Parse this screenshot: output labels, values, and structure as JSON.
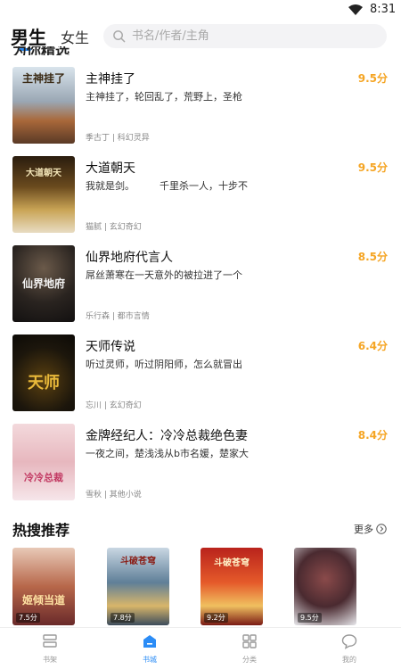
{
  "status_bar": {
    "time": "8:31"
  },
  "tabs": {
    "male": "男生",
    "female": "女生"
  },
  "search": {
    "placeholder": "书名/作者/主角"
  },
  "partial_section_title": "为你精选",
  "books": [
    {
      "title": "主神挂了",
      "desc": "主神挂了，轮回乱了，荒野上，圣枪",
      "author": "季古丁",
      "category": "科幻灵异",
      "score": "9.5分",
      "cover_text": "主神挂了"
    },
    {
      "title": "大道朝天",
      "desc": "我就是剑。        千里杀一人，十步不",
      "author": "猫腻",
      "category": "玄幻奇幻",
      "score": "9.5分",
      "cover_text": "大道朝天"
    },
    {
      "title": "仙界地府代言人",
      "desc": "屌丝萧寒在一天意外的被拉进了一个",
      "author": "乐行森",
      "category": "都市言情",
      "score": "8.5分",
      "cover_text": "仙界地府"
    },
    {
      "title": "天师传说",
      "desc": "听过灵师，听过阴阳师，怎么就冒出",
      "author": "忘川",
      "category": "玄幻奇幻",
      "score": "6.4分",
      "cover_text": "天师"
    },
    {
      "title": "金牌经纪人：冷冷总裁绝色妻",
      "desc": "一夜之间，楚浅浅从b市名媛，楚家大",
      "author": "雪秋",
      "category": "其他小说",
      "score": "8.4分",
      "cover_text": "冷冷总裁"
    }
  ],
  "hot_section": {
    "title": "热搜推荐",
    "more": "更多"
  },
  "hot_books": [
    {
      "cover_text": "姬倾当道",
      "score": "7.5分"
    },
    {
      "cover_text": "斗破苍穹",
      "score": "7.8分"
    },
    {
      "cover_text": "斗破苍穹",
      "score": "9.2分"
    },
    {
      "cover_text": "",
      "score": "9.5分"
    }
  ],
  "bottom_nav": [
    {
      "label": "书架",
      "icon": "bookshelf-icon"
    },
    {
      "label": "书城",
      "icon": "bookstore-icon"
    },
    {
      "label": "分类",
      "icon": "category-icon"
    },
    {
      "label": "我的",
      "icon": "profile-icon"
    }
  ],
  "colors": {
    "accent": "#2b8cf6",
    "score": "#f5a524"
  }
}
